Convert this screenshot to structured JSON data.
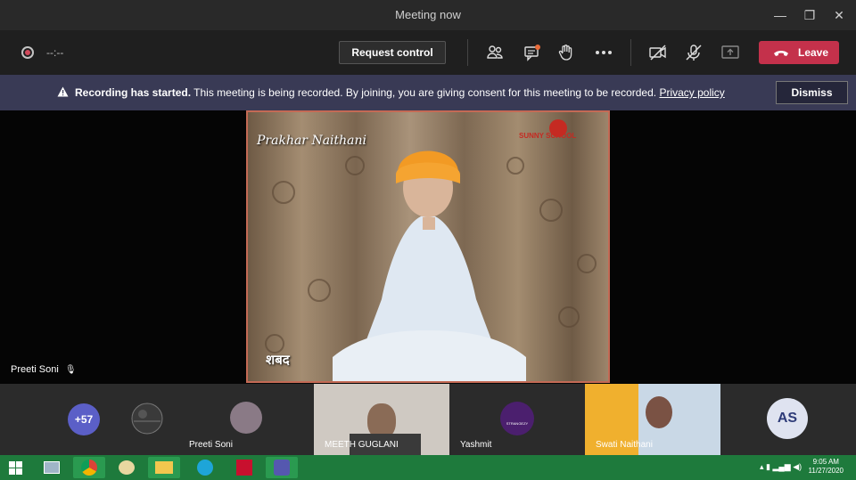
{
  "window": {
    "title": "Meeting now",
    "minimize": "—",
    "maximize": "❐",
    "close": "✕"
  },
  "toolbar": {
    "timer": "--:--",
    "request_control": "Request control",
    "leave": "Leave",
    "colors": {
      "leave_bg": "#c4314b"
    }
  },
  "banner": {
    "bold": "Recording has started.",
    "text": " This meeting is being recorded. By joining, you are giving consent for this meeting to be recorded. ",
    "link": "Privacy policy",
    "dismiss": "Dismiss"
  },
  "main_video": {
    "overlay_name": "Prakhar Naithani",
    "overlay_caption": "शबद",
    "logo_text": "SUNNY SCHOOL",
    "speaker_name": "Preeti Soni"
  },
  "participants": [
    {
      "label": "+57"
    },
    {
      "label": "Preeti Soni"
    },
    {
      "label": "MEETH GUGLANI"
    },
    {
      "label": "Yashmit",
      "avatar_text": "STRANGEZY"
    },
    {
      "label": "Swati Naithani"
    },
    {
      "label": "AS"
    }
  ],
  "taskbar": {
    "time": "9:05 AM",
    "date": "11/27/2020"
  }
}
